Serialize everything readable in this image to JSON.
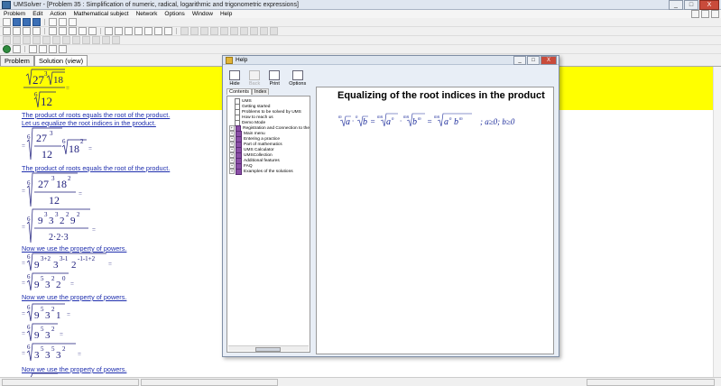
{
  "window": {
    "title": "UMSolver - [Problem 35 : Simplification of numeric, radical, logarithmic and trigonometric expressions]",
    "minimize": "_",
    "maximize": "□",
    "close": "X"
  },
  "menu": [
    "Problem",
    "Edit",
    "Action",
    "Mathematical subject",
    "Network",
    "Options",
    "Window",
    "Help"
  ],
  "tabs": [
    "Problem",
    "Solution (view)"
  ],
  "steps": {
    "s1": "The product of roots equals the root of the product.",
    "s2": "Let us equalize the root indices in the product.",
    "s3": "The product of roots equals the root of the product.",
    "s4": "Now we use the property of powers.",
    "s5": "Now we use the property of powers.",
    "s6": "Now we use the property of powers."
  },
  "help": {
    "title": "Help",
    "tools": [
      "Hide",
      "Back",
      "Print",
      "Options"
    ],
    "left_tabs": [
      "Contents",
      "Index"
    ],
    "tree": [
      {
        "label": "UMS",
        "icon": "doc",
        "expandable": false
      },
      {
        "label": "Getting started",
        "icon": "doc",
        "expandable": false
      },
      {
        "label": "Problems to be solved by UMS",
        "icon": "doc",
        "expandable": false
      },
      {
        "label": "How to reach us",
        "icon": "doc",
        "expandable": false
      },
      {
        "label": "Demo Mode",
        "icon": "doc",
        "expandable": false
      },
      {
        "label": "Registration and Connection to the",
        "icon": "book",
        "expandable": true
      },
      {
        "label": "Main menu",
        "icon": "book",
        "expandable": true
      },
      {
        "label": "Entering a practice",
        "icon": "book",
        "expandable": true
      },
      {
        "label": "Part of mathematics",
        "icon": "book",
        "expandable": true
      },
      {
        "label": "UMS Calculator",
        "icon": "book",
        "expandable": true
      },
      {
        "label": "UMSCollection",
        "icon": "book",
        "expandable": true
      },
      {
        "label": "Additional features",
        "icon": "book",
        "expandable": true
      },
      {
        "label": "FAQ",
        "icon": "book",
        "expandable": true
      },
      {
        "label": "Examples of the solutions",
        "icon": "book",
        "expandable": true
      }
    ],
    "content_heading": "Equalizing of the root indices in the product",
    "condition": "; a≥0; b≥0"
  }
}
